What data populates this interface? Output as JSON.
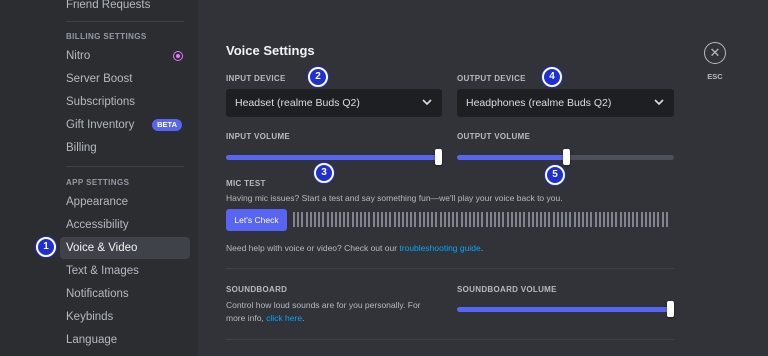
{
  "sidebar": {
    "top_item": "Friend Requests",
    "billing_header": "BILLING SETTINGS",
    "billing_items": [
      "Nitro",
      "Server Boost",
      "Subscriptions",
      "Gift Inventory",
      "Billing"
    ],
    "beta_badge": "BETA",
    "app_header": "APP SETTINGS",
    "app_items": [
      "Appearance",
      "Accessibility",
      "Voice & Video",
      "Text & Images",
      "Notifications",
      "Keybinds",
      "Language"
    ],
    "active_item": "Voice & Video"
  },
  "main": {
    "title": "Voice Settings",
    "input_device": {
      "label": "INPUT DEVICE",
      "value": "Headset (realme Buds Q2)",
      "icon": "chevron-down-icon"
    },
    "output_device": {
      "label": "OUTPUT DEVICE",
      "value": "Headphones (realme Buds Q2)",
      "icon": "chevron-down-icon"
    },
    "input_volume": {
      "label": "INPUT VOLUME",
      "level": 1.0
    },
    "output_volume": {
      "label": "OUTPUT VOLUME",
      "level": 0.5
    },
    "mic_test": {
      "label": "MIC TEST",
      "description": "Having mic issues? Start a test and say something fun—we'll play your voice back to you.",
      "button": "Let's Check"
    },
    "help": {
      "text": "Need help with voice or video? Check out our ",
      "link": "troubleshooting guide",
      "suffix": "."
    },
    "soundboard": {
      "label": "SOUNDBOARD",
      "line1": "Control how loud sounds are for you personally. For",
      "line2": "more info, ",
      "link": "click here",
      "suffix": ".",
      "volume_label": "SOUNDBOARD VOLUME",
      "level": 1.0
    }
  },
  "close": {
    "icon": "close-icon",
    "glyph": "✕",
    "label": "ESC"
  },
  "annotations": [
    "1",
    "2",
    "3",
    "4",
    "5"
  ],
  "colors": {
    "accent": "#5865f2",
    "link": "#00a8fc",
    "badge": "#1e2fd6",
    "nitro": "#e179ff"
  }
}
